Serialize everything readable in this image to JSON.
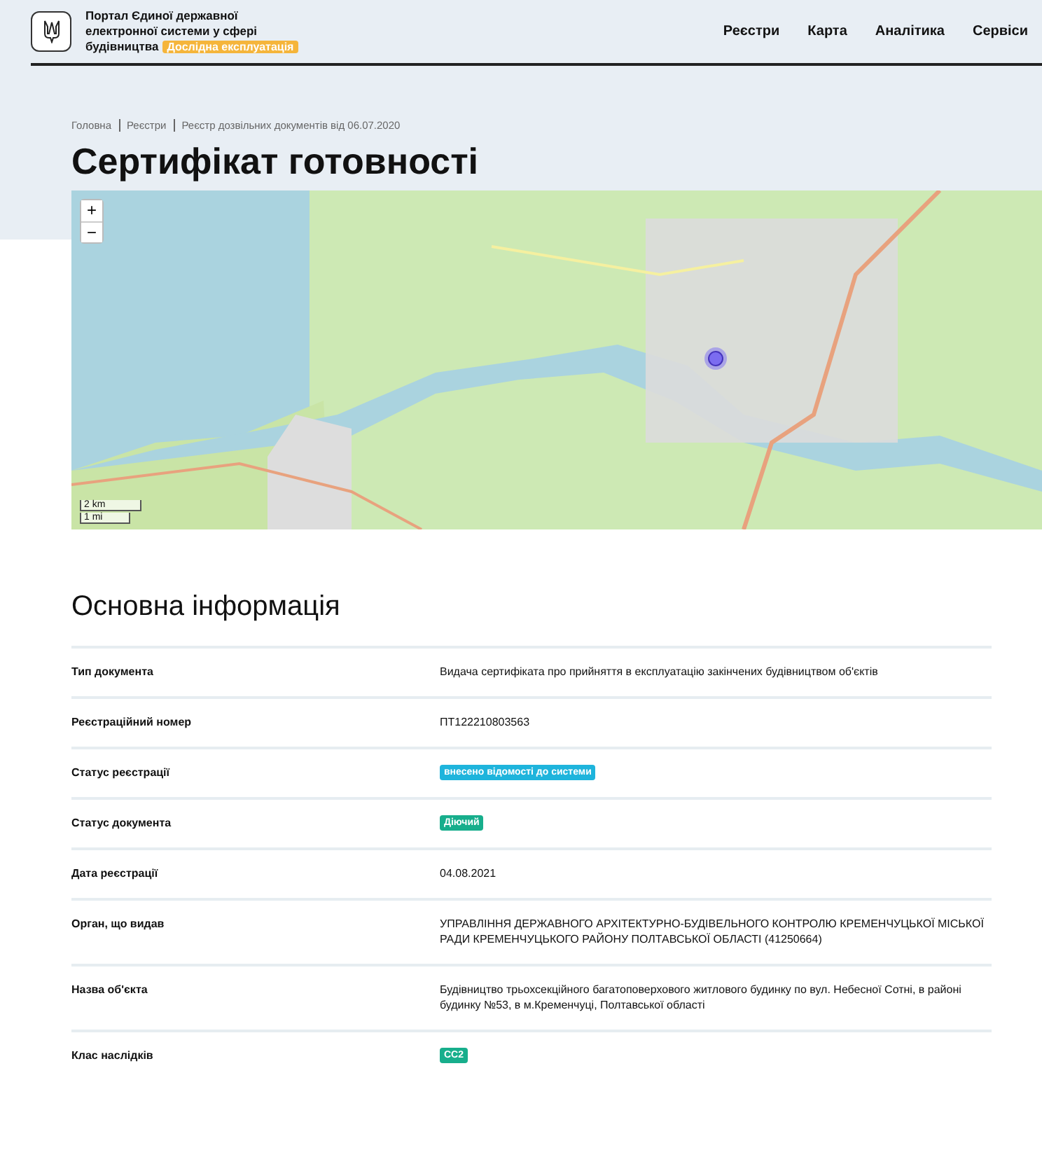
{
  "header": {
    "portal_title_lines": [
      "Портал Єдиної державної",
      "електронної системи у сфері",
      "будівництва"
    ],
    "badge": "Дослідна експлуатація",
    "nav": [
      "Реєстри",
      "Карта",
      "Аналітика",
      "Сервіси"
    ]
  },
  "breadcrumbs": [
    "Головна",
    "Реєстри",
    "Реєстр дозвільних документів від 06.07.2020"
  ],
  "page_title": "Сертифікат готовності",
  "map": {
    "zoom_in": "+",
    "zoom_out": "−",
    "scale": [
      "2 km",
      "1 mi"
    ]
  },
  "section_title": "Основна інформація",
  "rows": [
    {
      "label": "Тип документа",
      "kind": "text",
      "value": "Видача сертифіката про прийняття в експлуатацію закінчених будівництвом об'єктів"
    },
    {
      "label": "Реєстраційний номер",
      "kind": "text",
      "value": "ПТ122210803563"
    },
    {
      "label": "Статус реєстрації",
      "kind": "badge",
      "value": "внесено відомості до системи",
      "color": "#1eb4dc"
    },
    {
      "label": "Статус документа",
      "kind": "badge",
      "value": "Діючий",
      "color": "#17ae8c"
    },
    {
      "label": "Дата реєстрації",
      "kind": "text",
      "value": "04.08.2021"
    },
    {
      "label": "Орган, що видав",
      "kind": "text",
      "value": "УПРАВЛІННЯ ДЕРЖАВНОГО АРХІТЕКТУРНО-БУДІВЕЛЬНОГО КОНТРОЛЮ КРЕМЕНЧУЦЬКОЇ МІСЬКОЇ РАДИ КРЕМЕНЧУЦЬКОГО РАЙОНУ ПОЛТАВСЬКОЇ ОБЛАСТІ (41250664)"
    },
    {
      "label": "Назва об'єкта",
      "kind": "text",
      "value": "Будівництво трьохсекційного багатоповерхового житлового будинку по вул. Небесної Сотні, в районі будинку №53, в м.Кременчуці, Полтавської області"
    },
    {
      "label": "Клас наслідків",
      "kind": "badge",
      "value": "СС2",
      "color": "#17ae8c"
    }
  ]
}
